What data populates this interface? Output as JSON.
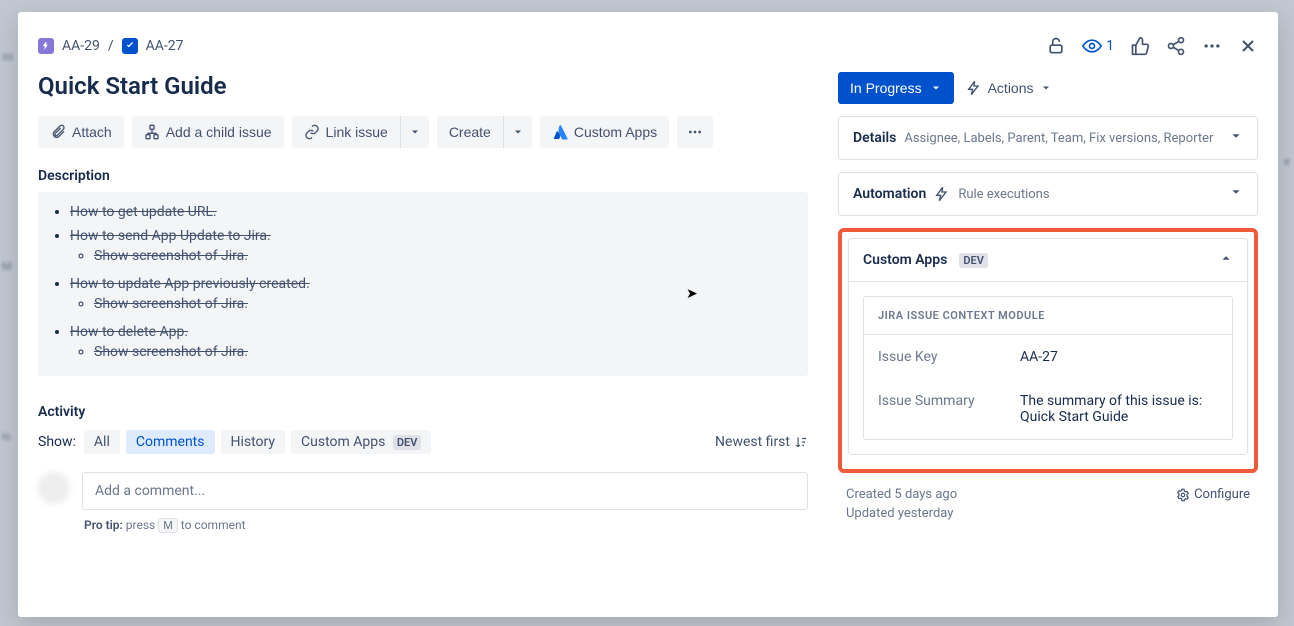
{
  "breadcrumb": {
    "parent_key": "AA-29",
    "child_key": "AA-27",
    "separator": "/"
  },
  "title": "Quick Start Guide",
  "topbar": {
    "watch_count": "1"
  },
  "toolbar": {
    "attach": "Attach",
    "add_child": "Add a child issue",
    "link_issue": "Link issue",
    "create": "Create",
    "custom_apps": "Custom Apps"
  },
  "description": {
    "heading": "Description",
    "items": [
      {
        "text": "How to get update URL.",
        "sub": []
      },
      {
        "text": "How to send App Update to Jira.",
        "sub": [
          "Show screenshot of Jira."
        ]
      },
      {
        "text": "How to update App previously created.",
        "sub": [
          "Show screenshot of Jira."
        ]
      },
      {
        "text": "How to delete App.",
        "sub": [
          "Show screenshot of Jira."
        ]
      }
    ]
  },
  "activity": {
    "heading": "Activity",
    "show_label": "Show:",
    "tabs": {
      "all": "All",
      "comments": "Comments",
      "history": "History",
      "custom_apps": "Custom Apps",
      "dev_badge": "DEV"
    },
    "sort": "Newest first",
    "comment_placeholder": "Add a comment...",
    "protip_prefix": "Pro tip:",
    "protip_text": " press ",
    "protip_key": "M",
    "protip_suffix": " to comment"
  },
  "status": {
    "label": "In Progress",
    "actions": "Actions"
  },
  "panels": {
    "details": {
      "title": "Details",
      "subtitle": "Assignee, Labels, Parent, Team, Fix versions, Reporter"
    },
    "automation": {
      "title": "Automation",
      "subtitle": "Rule executions"
    },
    "custom_apps": {
      "title": "Custom Apps",
      "badge": "DEV",
      "module_title": "JIRA ISSUE CONTEXT MODULE",
      "rows": {
        "issue_key": {
          "k": "Issue Key",
          "v": "AA-27"
        },
        "issue_summary": {
          "k": "Issue Summary",
          "v": "The summary of this issue is: Quick Start Guide"
        }
      }
    }
  },
  "meta": {
    "created": "Created 5 days ago",
    "updated": "Updated yesterday",
    "configure": "Configure"
  }
}
